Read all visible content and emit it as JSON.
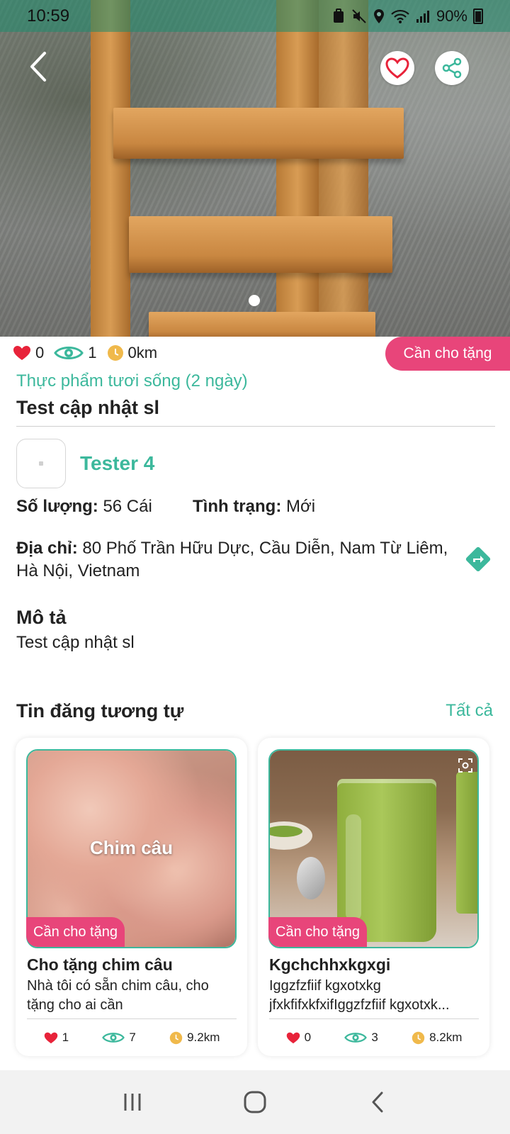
{
  "status_bar": {
    "time": "10:59",
    "battery": "90%"
  },
  "colors": {
    "accent": "#3cb89c",
    "tag": "#e8457a",
    "heart": "#e8233a",
    "clock": "#f0b94b"
  },
  "header": {
    "back_icon": "chevron-left-icon",
    "favorite_icon": "heart-outline-icon",
    "share_icon": "share-icon"
  },
  "post": {
    "stats": {
      "likes": "0",
      "views": "1",
      "distance": "0km"
    },
    "status_tag": "Cần cho tặng",
    "category": "Thực phẩm tươi sống (2 ngày)",
    "title": "Test cập nhật sl",
    "owner": "Tester 4",
    "quantity_label": "Số lượng:",
    "quantity_value": "56 Cái",
    "condition_label": "Tình trạng:",
    "condition_value": "Mới",
    "address_label": "Địa chỉ:",
    "address_value": "80 Phố Trần Hữu Dực, Cầu Diễn, Nam Từ Liêm, Hà Nội, Vietnam",
    "description_heading": "Mô tả",
    "description": "Test cập nhật sl"
  },
  "similar": {
    "heading": "Tin đăng tương tự",
    "see_all": "Tất cả",
    "items": [
      {
        "image_text": "Chim câu",
        "tag": "Cần cho tặng",
        "title": "Cho tặng chim câu",
        "desc_line1": "Nhà tôi có sẵn chim câu,  cho",
        "desc_line2": "tặng cho ai cần",
        "likes": "1",
        "views": "7",
        "distance": "9.2km"
      },
      {
        "image_text": "",
        "tag": "Cần cho tặng",
        "title": "Kgchchhxkgxgi",
        "desc_line1": "Iggzfzfiif kgxotxkg",
        "desc_line2": "jfxkfifxkfxifIggzfzfiif kgxotxk...",
        "likes": "0",
        "views": "3",
        "distance": "8.2km"
      }
    ]
  },
  "navbar": {
    "recent_icon": "recent-apps-icon",
    "home_icon": "home-icon",
    "back_icon": "back-icon"
  }
}
